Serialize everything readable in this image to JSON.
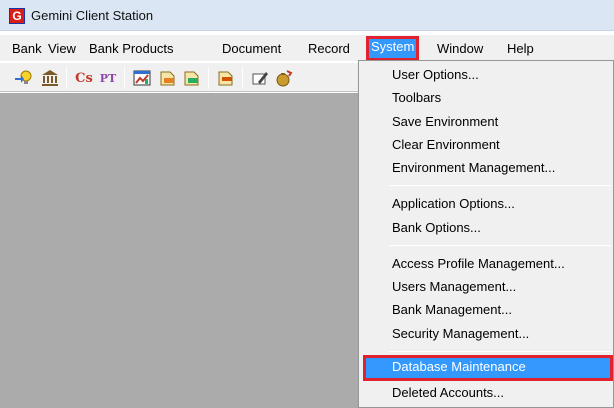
{
  "window": {
    "title": "Gemini Client Station",
    "icon_letter": "G"
  },
  "menubar": {
    "items": [
      {
        "label": "Bank",
        "active": false
      },
      {
        "label": "View",
        "active": false
      },
      {
        "label": "Bank Products",
        "active": false
      },
      {
        "label": "Document",
        "active": false
      },
      {
        "label": "Record",
        "active": false
      },
      {
        "label": "System",
        "active": true
      },
      {
        "label": "Window",
        "active": false
      },
      {
        "label": "Help",
        "active": false
      }
    ]
  },
  "toolbar": {
    "buttons": [
      {
        "icon": "user-lightbulb-icon"
      },
      {
        "icon": "bank-building-icon"
      },
      {
        "icon": "cs-icon",
        "text": "Cs"
      },
      {
        "icon": "pt-icon",
        "text": "PT"
      },
      {
        "icon": "chart-window-icon"
      },
      {
        "icon": "buy-document-icon"
      },
      {
        "icon": "sell-document-icon"
      },
      {
        "icon": "term-document-icon"
      },
      {
        "icon": "pen-note-icon"
      },
      {
        "icon": "money-bag-icon"
      }
    ]
  },
  "system_menu": {
    "groups": [
      {
        "items": [
          "User Options...",
          "Toolbars",
          "Save Environment",
          "Clear Environment",
          "Environment Management..."
        ]
      },
      {
        "items": [
          "Application Options...",
          "Bank Options..."
        ]
      },
      {
        "items": [
          "Access Profile Management...",
          "Users Management...",
          "Bank Management...",
          "Security Management..."
        ]
      },
      {
        "items": [
          "Database Maintenance",
          "Deleted Accounts..."
        ]
      }
    ],
    "highlighted_item": "Database Maintenance"
  },
  "colors": {
    "highlight_blue": "#3399ff",
    "outline_red": "#e0232e",
    "workspace_gray": "#ababab"
  }
}
